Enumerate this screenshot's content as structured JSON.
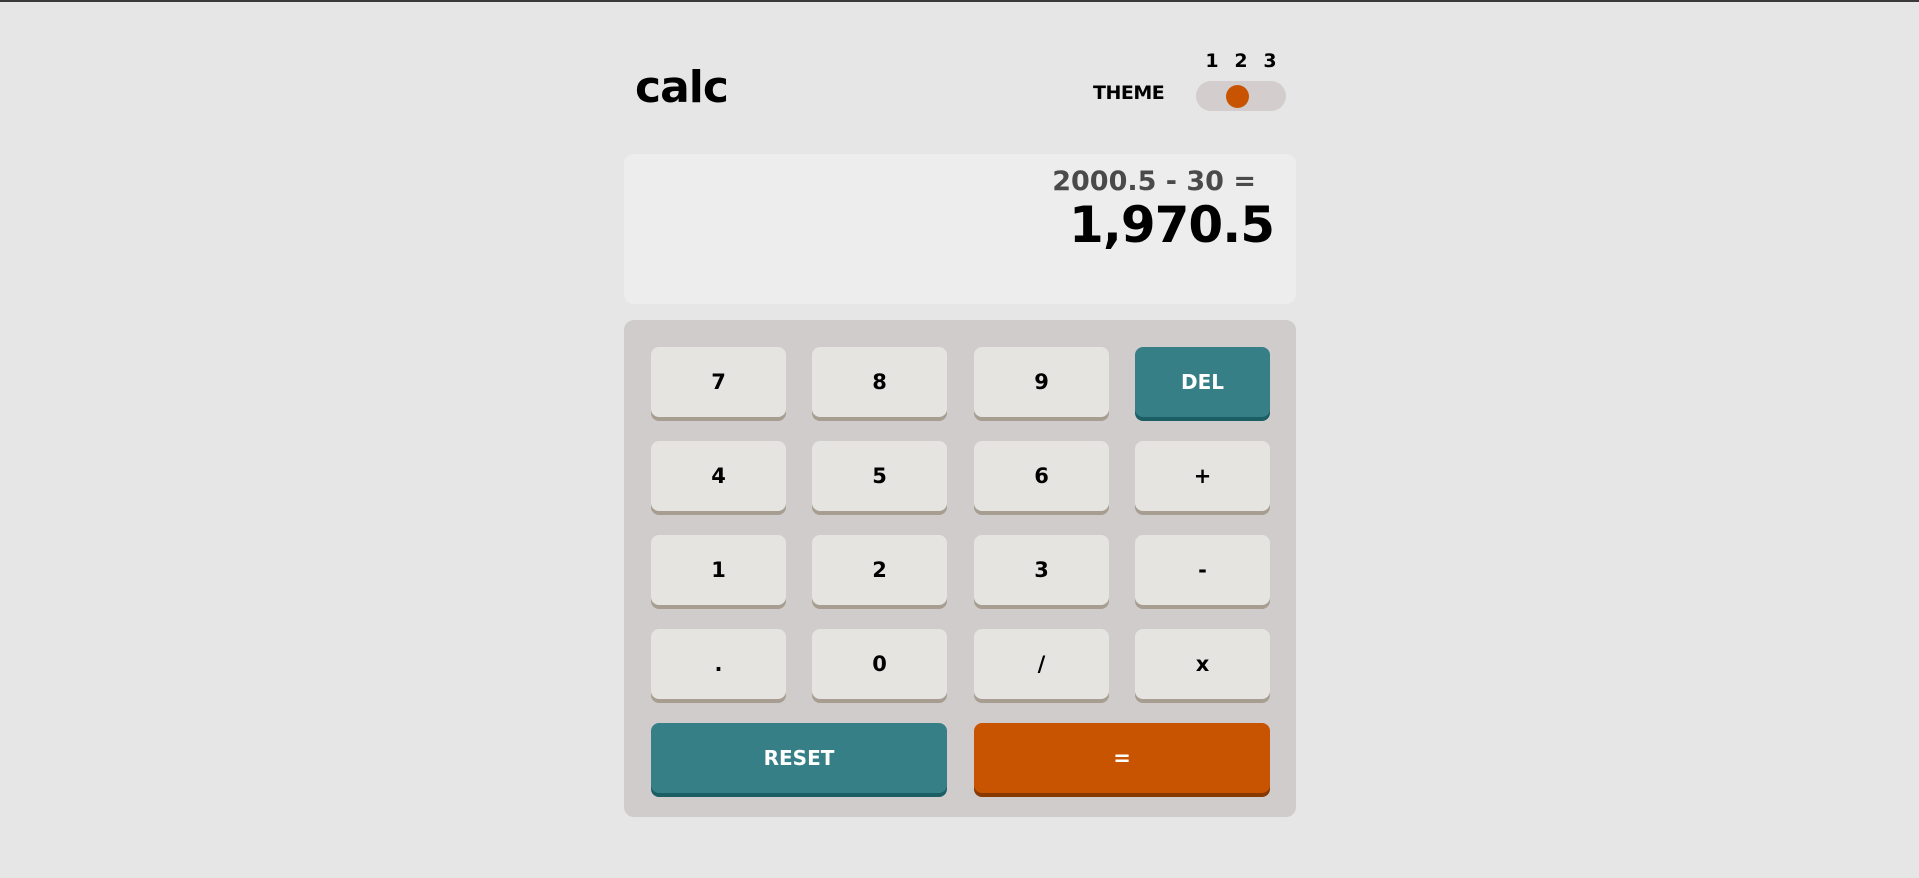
{
  "header": {
    "logo": "calc",
    "theme_label": "THEME",
    "theme_options": [
      "1",
      "2",
      "3"
    ],
    "active_theme": "2"
  },
  "screen": {
    "expression": "2000.5 - 30 =",
    "result": "1,970.5"
  },
  "keypad": {
    "keys": {
      "seven": "7",
      "eight": "8",
      "nine": "9",
      "del": "DEL",
      "four": "4",
      "five": "5",
      "six": "6",
      "plus": "+",
      "one": "1",
      "two": "2",
      "three": "3",
      "minus": "-",
      "decimal": ".",
      "zero": "0",
      "divide": "/",
      "multiply": "x",
      "reset": "RESET",
      "equals": "="
    }
  },
  "colors": {
    "background": "#e6e6e6",
    "screen": "#ededed",
    "keypad": "#d1cccc",
    "key": "#e5e4e1",
    "key_shadow": "#a79e91",
    "func_key": "#377f86",
    "func_key_shadow": "#1b5f65",
    "accent": "#c85401",
    "accent_shadow": "#873901"
  }
}
